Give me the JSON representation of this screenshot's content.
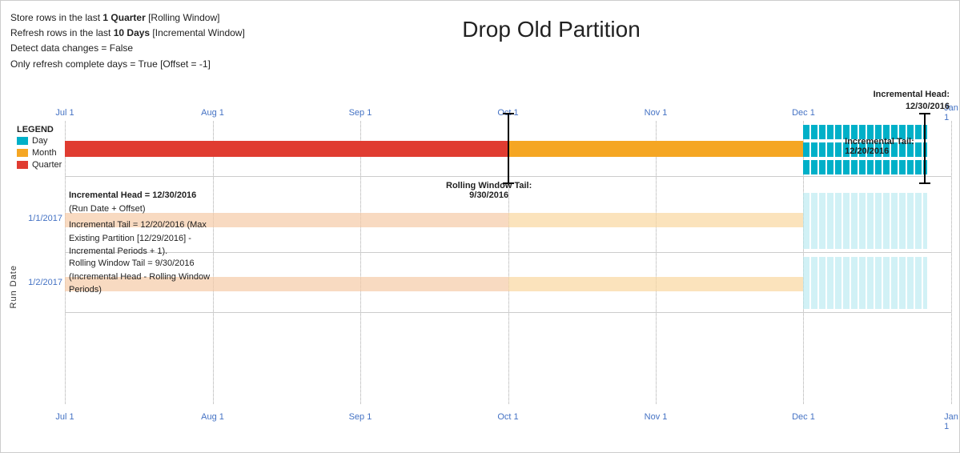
{
  "title": "Drop Old Partition",
  "header": {
    "line1_prefix": "Store rows in the last ",
    "line1_bold": "1 Quarter",
    "line1_suffix": " [Rolling Window]",
    "line2_prefix": "Refresh rows in the last ",
    "line2_bold": "10 Days",
    "line2_suffix": " [Incremental Window]",
    "line3": "Detect data changes = False",
    "line4": "Only refresh complete days = True [Offset = -1]"
  },
  "legend": {
    "title": "LEGEND",
    "items": [
      {
        "label": "Day",
        "color": "#00B0C8"
      },
      {
        "label": "Month",
        "color": "#F5A623"
      },
      {
        "label": "Quarter",
        "color": "#E03C31"
      }
    ]
  },
  "axis": {
    "labels": [
      "Jul 1",
      "Aug 1",
      "Sep 1",
      "Oct 1",
      "Nov 1",
      "Dec 1",
      "Jan 1"
    ],
    "positions": [
      0,
      16.67,
      33.33,
      50,
      66.67,
      83.33,
      100
    ]
  },
  "annotations": {
    "incremental_head_label": "Incremental Head:\n12/30/2016",
    "rolling_window_tail_label": "Rolling Window Tail:\n9/30/2016",
    "incremental_tail_label": "Incremental Tail:\n12/20/2016",
    "run_date": "Run Date",
    "row1_label": "1/1/2017",
    "row2_label": "1/2/2017",
    "info_head": "Incremental Head = 12/30/2016\n(Run Date + Offset)",
    "info_tail": "Incremental Tail = 12/20/2016 (Max\nExisting Partition [12/29/2016] -\nIncremental Periods + 1).",
    "info_rolling": "Rolling Window Tail = 9/30/2016\n(Incremental Head - Rolling Window\nPeriods)"
  },
  "colors": {
    "quarter_red": "#E03C31",
    "month_orange": "#F5A623",
    "day_teal": "#00B0C8",
    "day_teal_light": "#B2E8EF",
    "month_light": "#FAD7A0",
    "quarter_light": "#F5CBA7",
    "axis_blue": "#4472C4",
    "black": "#000000"
  }
}
